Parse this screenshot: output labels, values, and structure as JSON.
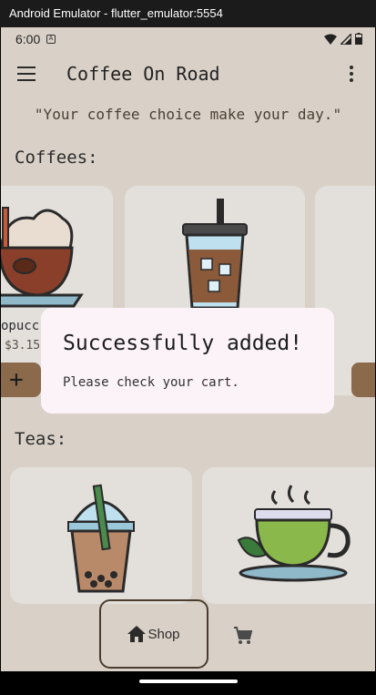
{
  "window": {
    "title": "Android Emulator - flutter_emulator:5554"
  },
  "status_bar": {
    "time": "6:00",
    "notification": "A"
  },
  "app_bar": {
    "title": "Coffee On Road"
  },
  "quote": "\"Your coffee choice make your day.\"",
  "sections": {
    "coffees": {
      "title": "Coffees:",
      "partial_name": "opucc",
      "partial_price": "$3.15",
      "add_label": "+"
    },
    "teas": {
      "title": "Teas:"
    }
  },
  "bottom_nav": {
    "shop_label": "Shop"
  },
  "dialog": {
    "title": "Successfully added!",
    "message": "Please check your cart."
  },
  "colors": {
    "brand_brown": "#8a6a4a",
    "dialog_bg": "#fbf3f8",
    "app_bg": "#d9d1c7"
  }
}
